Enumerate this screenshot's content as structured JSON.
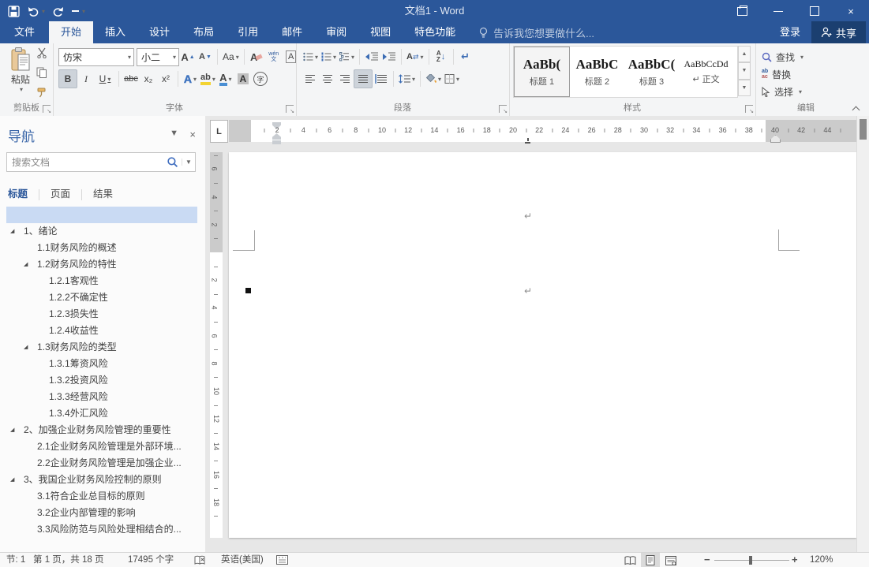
{
  "titlebar": {
    "title": "文档1 - Word",
    "tell_me": "告诉我您想要做什么...",
    "signin": "登录",
    "share": "共享"
  },
  "tabs": [
    {
      "label": "文件",
      "file": true
    },
    {
      "label": "开始",
      "active": true
    },
    {
      "label": "插入"
    },
    {
      "label": "设计"
    },
    {
      "label": "布局"
    },
    {
      "label": "引用"
    },
    {
      "label": "邮件"
    },
    {
      "label": "审阅"
    },
    {
      "label": "视图"
    },
    {
      "label": "特色功能"
    }
  ],
  "ribbon": {
    "clipboard": {
      "paste": "粘贴",
      "label": "剪贴板"
    },
    "font": {
      "label": "字体",
      "font_name": "仿宋",
      "font_size": "小二"
    },
    "paragraph": {
      "label": "段落"
    },
    "styles": {
      "label": "样式",
      "items": [
        {
          "preview": "AaBb(",
          "name": "标题 1",
          "selected": true
        },
        {
          "preview": "AaBbC",
          "name": "标题 2"
        },
        {
          "preview": "AaBbC(",
          "name": "标题 3"
        },
        {
          "preview": "AaBbCcDd",
          "name": "↵ 正文",
          "small": true
        }
      ]
    },
    "editing": {
      "label": "编辑",
      "find": "查找",
      "replace": "替换",
      "select": "选择"
    }
  },
  "icons": {
    "expand": "◢",
    "caret": "▾",
    "close": "×",
    "bold": "B",
    "italic": "I",
    "underline": "U",
    "strikethrough": "abc",
    "subscript": "x₂",
    "superscript": "x²",
    "grow_font": "A",
    "shrink_font": "A",
    "change_case": "Aa",
    "clear_formatting": "A",
    "phonetic_top": "wén",
    "phonetic_bottom": "文",
    "char_border": "A",
    "text_effects": "A",
    "highlight": "ab",
    "font_color": "A",
    "char_shading": "A",
    "enclose_char": "字",
    "sort_a": "A",
    "sort_z": "Z",
    "sort_arrow": "↓",
    "show_marks": "↵",
    "replace_top": "ab",
    "replace_bottom": "ac",
    "tab_selector": "L",
    "paragraph_mark": "↵"
  },
  "nav": {
    "title": "导航",
    "search_placeholder": "搜索文档",
    "tabs": [
      "标题",
      "页面",
      "结果"
    ],
    "items": [
      {
        "level": 1,
        "text": "",
        "selected": true
      },
      {
        "level": 1,
        "text": "1、绪论",
        "expand": true
      },
      {
        "level": 2,
        "text": "1.1财务风险的概述"
      },
      {
        "level": 2,
        "text": "1.2财务风险的特性",
        "expand": true
      },
      {
        "level": 3,
        "text": "1.2.1客观性"
      },
      {
        "level": 3,
        "text": "1.2.2不确定性"
      },
      {
        "level": 3,
        "text": "1.2.3损失性"
      },
      {
        "level": 3,
        "text": "1.2.4收益性"
      },
      {
        "level": 2,
        "text": "1.3财务风险的类型",
        "expand": true
      },
      {
        "level": 3,
        "text": "1.3.1筹资风险"
      },
      {
        "level": 3,
        "text": "1.3.2投资风险"
      },
      {
        "level": 3,
        "text": "1.3.3经营风险"
      },
      {
        "level": 3,
        "text": "1.3.4外汇风险"
      },
      {
        "level": 1,
        "text": "2、加强企业财务风险管理的重要性",
        "expand": true
      },
      {
        "level": 2,
        "text": "2.1企业财务风险管理是外部环境..."
      },
      {
        "level": 2,
        "text": "2.2企业财务风险管理是加强企业..."
      },
      {
        "level": 1,
        "text": "3、我国企业财务风险控制的原则",
        "expand": true
      },
      {
        "level": 2,
        "text": "3.1符合企业总目标的原则"
      },
      {
        "level": 2,
        "text": "3.2企业内部管理的影响"
      },
      {
        "level": 2,
        "text": "3.3风险防范与风险处理相结合的..."
      }
    ]
  },
  "ruler": {
    "h_units": [
      2,
      4,
      6,
      8,
      10,
      12,
      14,
      16,
      18,
      20,
      22,
      24,
      26,
      28,
      30,
      32,
      34,
      36,
      38,
      40,
      42,
      44
    ],
    "v_top_units": [
      6,
      4,
      2
    ],
    "v_units": [
      2,
      4,
      6,
      8,
      10,
      12,
      14,
      16,
      18
    ]
  },
  "statusbar": {
    "section": "节: 1",
    "page": "第 1 页，共 18 页",
    "words": "17495 个字",
    "language": "英语(美国)",
    "zoom": "120%"
  },
  "colors": {
    "titlebar": "#2b579a",
    "share_button": "#1b3f70",
    "nav_selection": "#c9daf3",
    "doc_background": "#e7e7e7",
    "page": "#ffffff"
  }
}
